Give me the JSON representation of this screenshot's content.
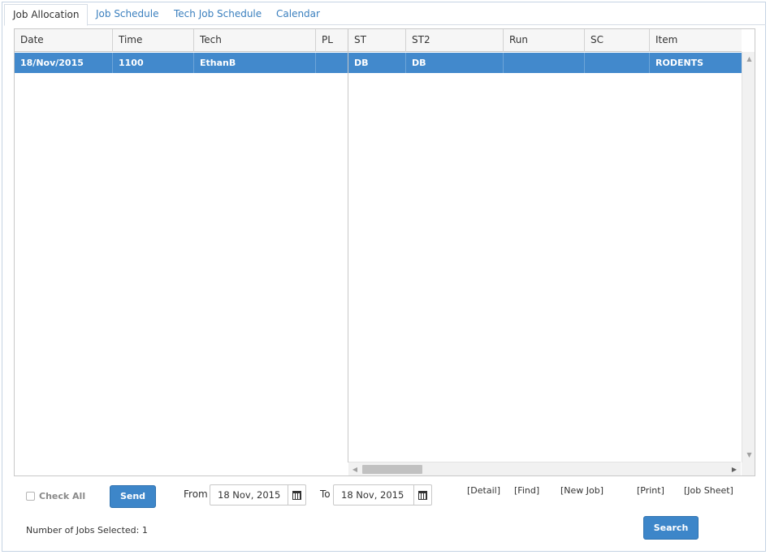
{
  "tabs": [
    {
      "label": "Job Allocation",
      "active": true
    },
    {
      "label": "Job Schedule",
      "active": false
    },
    {
      "label": "Tech Job Schedule",
      "active": false
    },
    {
      "label": "Calendar",
      "active": false
    }
  ],
  "grid": {
    "columns": [
      "Date",
      "Time",
      "Tech",
      "PL",
      "ST",
      "ST2",
      "Run",
      "SC",
      "Item"
    ],
    "rows": [
      {
        "date": "18/Nov/2015",
        "time": "1100",
        "tech": "EthanB",
        "pl": "",
        "st": "DB",
        "st2": "DB",
        "run": "",
        "sc": "",
        "item": "RODENTS",
        "selected": true
      }
    ]
  },
  "controls": {
    "check_all_label": "Check All",
    "send_label": "Send",
    "from_label": "From",
    "from_value": "18 Nov, 2015",
    "to_label": "To",
    "to_value": "18 Nov, 2015",
    "search_label": "Search",
    "links": [
      "[Detail]",
      "[Find]",
      "[New Job]",
      "[Print]",
      "[Job Sheet]"
    ]
  },
  "status": {
    "jobs_selected": "Number of Jobs Selected: 1"
  },
  "colors": {
    "accent": "#3d86c9",
    "row_selected": "#4289cc",
    "tab_link": "#3a7fbe"
  },
  "icons": {
    "calendar": "calendar-icon",
    "scroll_up": "arrow-up-icon",
    "scroll_down": "arrow-down-icon",
    "scroll_left": "arrow-left-icon",
    "scroll_right": "arrow-right-icon"
  }
}
